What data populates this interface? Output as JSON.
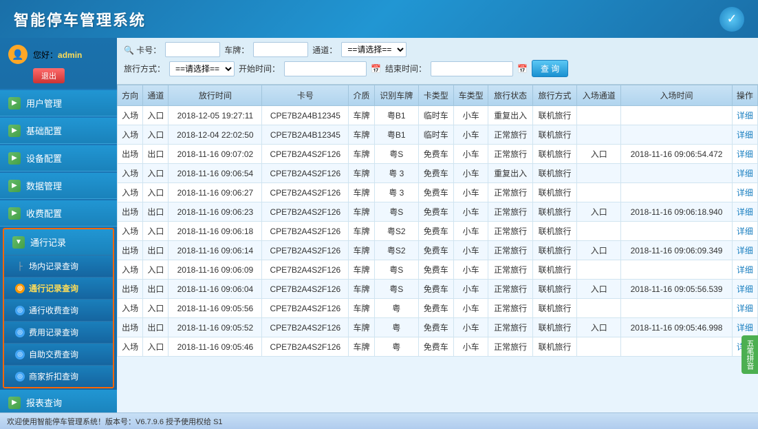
{
  "header": {
    "title": "智能停车管理系统",
    "icon": "✓"
  },
  "user": {
    "greeting": "您好：",
    "name": "admin",
    "logout_label": "退出"
  },
  "sidebar": {
    "nav_items": [
      {
        "label": "用户管理",
        "icon": "▶"
      },
      {
        "label": "基础配置",
        "icon": "▶"
      },
      {
        "label": "设备配置",
        "icon": "▶"
      },
      {
        "label": "数据管理",
        "icon": "▶"
      },
      {
        "label": "收费配置",
        "icon": "▶"
      }
    ],
    "group": {
      "label": "通行记录",
      "icon": "▼",
      "sub_items": [
        {
          "label": "场内记录查询",
          "icon_type": "tree"
        },
        {
          "label": "通行记录查询",
          "icon_type": "orange",
          "active": true
        },
        {
          "label": "通行收费查询",
          "icon_type": "blue"
        },
        {
          "label": "费用记录查询",
          "icon_type": "blue"
        },
        {
          "label": "自助交费查询",
          "icon_type": "blue"
        },
        {
          "label": "商家折扣查询",
          "icon_type": "blue"
        }
      ]
    },
    "report": {
      "label": "报表查询",
      "icon": "▶"
    }
  },
  "search": {
    "card_label": "🔍 卡号：",
    "plate_label": "车牌：",
    "channel_label": "通道：",
    "channel_placeholder": "==请选择==",
    "travel_label": "旅行方式：",
    "travel_placeholder": "==请选择==",
    "start_time_label": "开始时间：",
    "end_time_label": "结束时间：",
    "query_btn": "查 询"
  },
  "table": {
    "headers": [
      "方向",
      "通道",
      "放行时间",
      "卡号",
      "介质",
      "识别车牌",
      "卡类型",
      "车类型",
      "旅行状态",
      "旅行方式",
      "入场通道",
      "入场时间",
      "操作"
    ],
    "rows": [
      {
        "direction": "入场",
        "channel": "入口",
        "time": "2018-12-05 19:27:11",
        "card": "CPE7B2A4B12345",
        "media": "车牌",
        "plate": "粤B1",
        "card_type": "临时车",
        "car_type": "小车",
        "travel_status": "重复出入",
        "travel_mode": "联机旅行",
        "entry_channel": "",
        "entry_time": "",
        "op": "详细"
      },
      {
        "direction": "入场",
        "channel": "入口",
        "time": "2018-12-04 22:02:50",
        "card": "CPE7B2A4B12345",
        "media": "车牌",
        "plate": "粤B1",
        "card_type": "临时车",
        "car_type": "小车",
        "travel_status": "正常旅行",
        "travel_mode": "联机旅行",
        "entry_channel": "",
        "entry_time": "",
        "op": "详细"
      },
      {
        "direction": "出场",
        "channel": "出口",
        "time": "2018-11-16 09:07:02",
        "card": "CPE7B2A4S2F126",
        "media": "车牌",
        "plate": "粤S",
        "card_type": "免费车",
        "car_type": "小车",
        "travel_status": "正常旅行",
        "travel_mode": "联机旅行",
        "entry_channel": "入口",
        "entry_time": "2018-11-16\n09:06:54.472",
        "op": "详细"
      },
      {
        "direction": "入场",
        "channel": "入口",
        "time": "2018-11-16 09:06:54",
        "card": "CPE7B2A4S2F126",
        "media": "车牌",
        "plate": "粤 3",
        "card_type": "免费车",
        "car_type": "小车",
        "travel_status": "重复出入",
        "travel_mode": "联机旅行",
        "entry_channel": "",
        "entry_time": "",
        "op": "详细"
      },
      {
        "direction": "入场",
        "channel": "入口",
        "time": "2018-11-16 09:06:27",
        "card": "CPE7B2A4S2F126",
        "media": "车牌",
        "plate": "粤 3",
        "card_type": "免费车",
        "car_type": "小车",
        "travel_status": "正常旅行",
        "travel_mode": "联机旅行",
        "entry_channel": "",
        "entry_time": "",
        "op": "详细"
      },
      {
        "direction": "出场",
        "channel": "出口",
        "time": "2018-11-16 09:06:23",
        "card": "CPE7B2A4S2F126",
        "media": "车牌",
        "plate": "粤S",
        "card_type": "免费车",
        "car_type": "小车",
        "travel_status": "正常旅行",
        "travel_mode": "联机旅行",
        "entry_channel": "入口",
        "entry_time": "2018-11-16\n09:06:18.940",
        "op": "详细"
      },
      {
        "direction": "入场",
        "channel": "入口",
        "time": "2018-11-16 09:06:18",
        "card": "CPE7B2A4S2F126",
        "media": "车牌",
        "plate": "粤S2",
        "card_type": "免费车",
        "car_type": "小车",
        "travel_status": "正常旅行",
        "travel_mode": "联机旅行",
        "entry_channel": "",
        "entry_time": "",
        "op": "详细"
      },
      {
        "direction": "出场",
        "channel": "出口",
        "time": "2018-11-16 09:06:14",
        "card": "CPE7B2A4S2F126",
        "media": "车牌",
        "plate": "粤S2",
        "card_type": "免费车",
        "car_type": "小车",
        "travel_status": "正常旅行",
        "travel_mode": "联机旅行",
        "entry_channel": "入口",
        "entry_time": "2018-11-16\n09:06:09.349",
        "op": "详细"
      },
      {
        "direction": "入场",
        "channel": "入口",
        "time": "2018-11-16 09:06:09",
        "card": "CPE7B2A4S2F126",
        "media": "车牌",
        "plate": "粤S",
        "card_type": "免费车",
        "car_type": "小车",
        "travel_status": "正常旅行",
        "travel_mode": "联机旅行",
        "entry_channel": "",
        "entry_time": "",
        "op": "详细"
      },
      {
        "direction": "出场",
        "channel": "出口",
        "time": "2018-11-16 09:06:04",
        "card": "CPE7B2A4S2F126",
        "media": "车牌",
        "plate": "粤S",
        "card_type": "免费车",
        "car_type": "小车",
        "travel_status": "正常旅行",
        "travel_mode": "联机旅行",
        "entry_channel": "入口",
        "entry_time": "2018-11-16\n09:05:56.539",
        "op": "详细"
      },
      {
        "direction": "入场",
        "channel": "入口",
        "time": "2018-11-16 09:05:56",
        "card": "CPE7B2A4S2F126",
        "media": "车牌",
        "plate": "粤",
        "card_type": "免费车",
        "car_type": "小车",
        "travel_status": "正常旅行",
        "travel_mode": "联机旅行",
        "entry_channel": "",
        "entry_time": "",
        "op": "详细"
      },
      {
        "direction": "出场",
        "channel": "出口",
        "time": "2018-11-16 09:05:52",
        "card": "CPE7B2A4S2F126",
        "media": "车牌",
        "plate": "粤",
        "card_type": "免费车",
        "car_type": "小车",
        "travel_status": "正常旅行",
        "travel_mode": "联机旅行",
        "entry_channel": "入口",
        "entry_time": "2018-11-16\n09:05:46.998",
        "op": "详细"
      },
      {
        "direction": "入场",
        "channel": "入口",
        "time": "2018-11-16 09:05:46",
        "card": "CPE7B2A4S2F126",
        "media": "车牌",
        "plate": "粤",
        "card_type": "免费车",
        "car_type": "小车",
        "travel_status": "正常旅行",
        "travel_mode": "联机旅行",
        "entry_channel": "",
        "entry_time": "",
        "op": "详细"
      }
    ]
  },
  "status_bar": {
    "text": "欢迎使用智能停车管理系统！版本号：V6.7.9.6    授予使用权给 S1"
  },
  "float_btn": {
    "label": "五笔拼音"
  }
}
